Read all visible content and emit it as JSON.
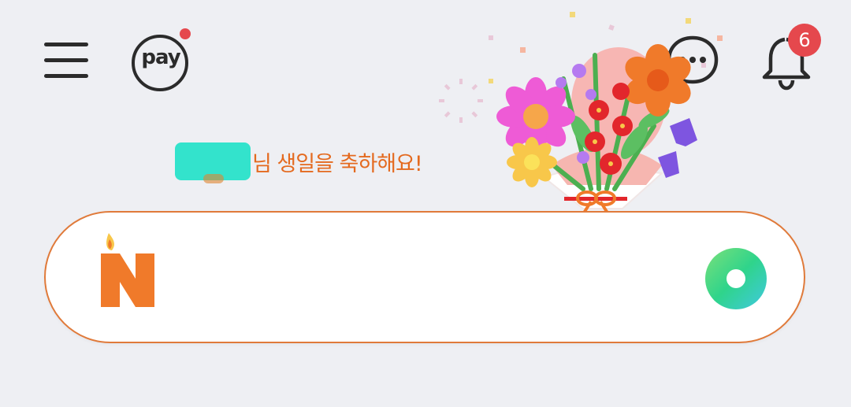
{
  "header": {
    "menu_icon": "hamburger-menu-icon",
    "pay": {
      "label": "pay",
      "has_notification_dot": true,
      "dot_color": "#e5484d"
    },
    "chat_icon": "chat-bubble-icon",
    "notifications": {
      "icon": "bell-icon",
      "badge_count": "6",
      "badge_color": "#e5484d"
    }
  },
  "greeting": {
    "name_redacted": true,
    "text": "님 생일을 축하해요!",
    "text_color": "#e46a1f",
    "illustration": "flower-bouquet"
  },
  "search": {
    "logo": "naver-n-birthday-candle-logo",
    "placeholder": "",
    "value": "",
    "border_color": "#e07a3a",
    "lens_icon": "green-lens-icon"
  },
  "colors": {
    "background": "#eeeff3",
    "accent_orange": "#f07a2a",
    "accent_green": "#2fd48b"
  }
}
